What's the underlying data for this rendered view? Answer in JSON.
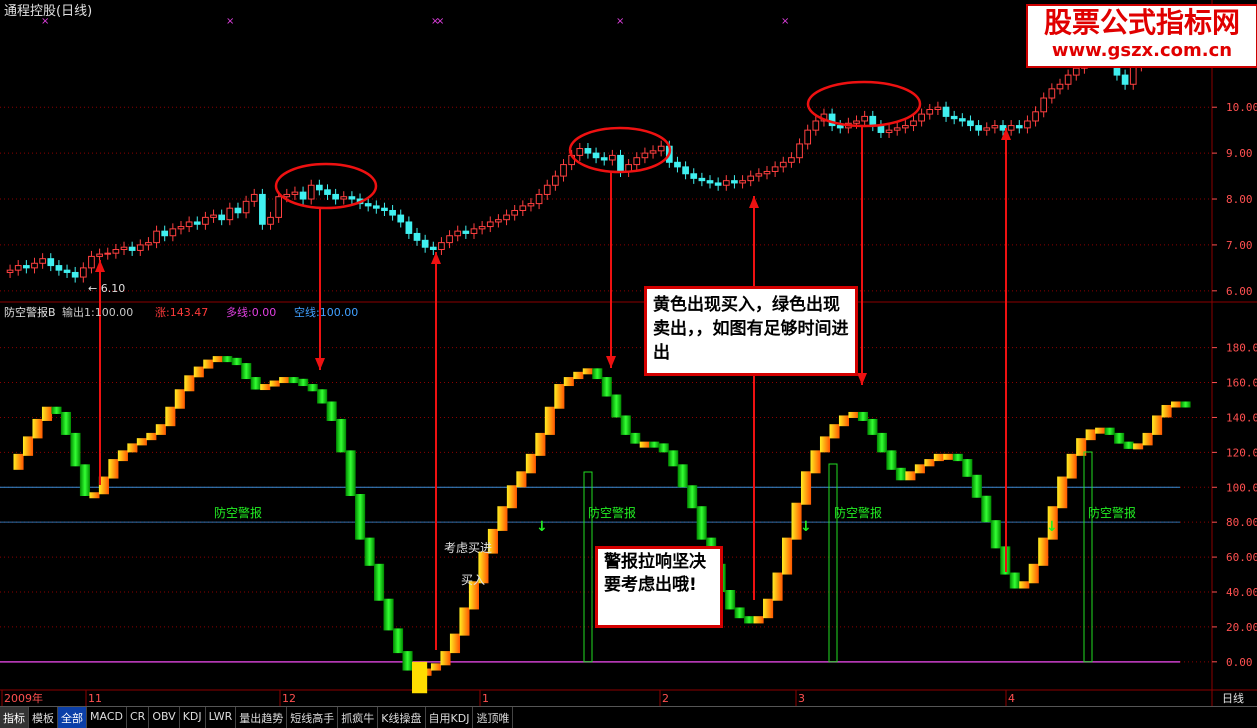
{
  "title": "通程控股(日线)",
  "brand": {
    "name": "股票公式指标网",
    "url": "www.gszx.com.cn"
  },
  "indicator": {
    "name": "防空警报B",
    "readouts": [
      {
        "label": "输出1",
        "value": "100.00",
        "color": "#c8c8c8"
      },
      {
        "label": "涨",
        "value": "143.47",
        "color": "#ff3a3a"
      },
      {
        "label": "多线",
        "value": "0.00",
        "color": "#e040e0"
      },
      {
        "label": "空线",
        "value": "100.00",
        "color": "#40a0ff"
      }
    ]
  },
  "low_marker": "6.10",
  "annotations": {
    "note1": "黄色出现买入，绿色出现卖出，，如图有足够时间进出",
    "note2": "警报拉响坚决要考虑出哦!",
    "consider_buy": "考虑买进",
    "buy": "买入",
    "alarm": "防空警报"
  },
  "axis": {
    "x_labels": [
      "2009年",
      "11",
      "12",
      "1",
      "2",
      "3",
      "4"
    ],
    "corner": "日线",
    "price_ticks": [
      "6.00",
      "7.00",
      "8.00",
      "9.00",
      "10.00"
    ],
    "osc_ticks": [
      "0.00",
      "20.00",
      "40.00",
      "60.00",
      "80.00",
      "100.00",
      "120.00",
      "140.00",
      "160.00",
      "180.00"
    ]
  },
  "tabs": [
    "指标",
    "模板",
    "全部",
    "MACD",
    "CR",
    "OBV",
    "KDJ",
    "LWR",
    "量出趋势",
    "短线高手",
    "抓疯牛",
    "K线操盘",
    "自用KDJ",
    "逃顶唯"
  ],
  "colors": {
    "up": "#ff4040",
    "down": "#40f0f0",
    "buy": "#ffdd00",
    "sell": "#00dd00",
    "arrow": "#ee1111",
    "grid": "#8b0000"
  },
  "chart_data": [
    {
      "type": "candlestick",
      "title": "通程控股(日线)",
      "ylim": [
        5.8,
        11.9
      ],
      "yticks": [
        6,
        7,
        8,
        9,
        10
      ],
      "close": [
        6.45,
        6.55,
        6.5,
        6.6,
        6.7,
        6.55,
        6.45,
        6.4,
        6.3,
        6.5,
        6.75,
        6.8,
        6.82,
        6.9,
        6.95,
        6.88,
        7,
        7.05,
        7.3,
        7.2,
        7.35,
        7.4,
        7.5,
        7.45,
        7.6,
        7.65,
        7.55,
        7.8,
        7.7,
        7.95,
        8.1,
        7.45,
        7.6,
        8.05,
        8.1,
        8.15,
        8.0,
        8.3,
        8.2,
        8.1,
        8.0,
        8.05,
        8.0,
        7.9,
        7.85,
        7.8,
        7.75,
        7.65,
        7.5,
        7.25,
        7.1,
        6.95,
        6.9,
        7.05,
        7.2,
        7.3,
        7.25,
        7.35,
        7.4,
        7.5,
        7.55,
        7.65,
        7.75,
        7.85,
        7.9,
        8.1,
        8.3,
        8.5,
        8.75,
        8.95,
        9.1,
        9.0,
        8.9,
        8.85,
        8.95,
        8.6,
        8.75,
        8.9,
        9.0,
        9.05,
        9.15,
        8.8,
        8.7,
        8.55,
        8.45,
        8.4,
        8.35,
        8.3,
        8.4,
        8.35,
        8.4,
        8.5,
        8.55,
        8.6,
        8.7,
        8.8,
        8.9,
        9.2,
        9.5,
        9.7,
        9.85,
        9.6,
        9.55,
        9.65,
        9.7,
        9.8,
        9.6,
        9.45,
        9.5,
        9.55,
        9.6,
        9.7,
        9.85,
        9.95,
        10.0,
        9.8,
        9.75,
        9.7,
        9.6,
        9.5,
        9.55,
        9.6,
        9.5,
        9.6,
        9.55,
        9.7,
        9.9,
        10.2,
        10.4,
        10.5,
        10.7,
        10.85,
        11.0,
        11.1,
        11.3,
        11.0,
        10.7,
        10.5,
        10.9,
        11.2,
        11.4,
        11.3,
        11.35,
        11.4
      ],
      "low_label": 6.1
    },
    {
      "type": "area",
      "title": "防空警报B",
      "ylim": [
        -15,
        205
      ],
      "yticks": [
        0,
        20,
        40,
        60,
        80,
        100,
        120,
        140,
        160,
        180
      ],
      "values": [
        110,
        118,
        128,
        138,
        145,
        142,
        130,
        112,
        95,
        96,
        105,
        115,
        120,
        124,
        127,
        130,
        135,
        145,
        155,
        163,
        168,
        172,
        174,
        173,
        170,
        162,
        156,
        158,
        160,
        162,
        161,
        158,
        155,
        148,
        138,
        120,
        95,
        70,
        55,
        35,
        18,
        5,
        -5,
        -8,
        -5,
        -2,
        5,
        15,
        30,
        45,
        62,
        75,
        88,
        100,
        108,
        118,
        130,
        145,
        158,
        162,
        165,
        167,
        162,
        152,
        140,
        130,
        125,
        125,
        124,
        120,
        112,
        100,
        88,
        70,
        55,
        40,
        30,
        25,
        22,
        25,
        35,
        50,
        70,
        90,
        108,
        120,
        128,
        135,
        140,
        142,
        138,
        130,
        120,
        110,
        104,
        108,
        112,
        115,
        118,
        118,
        115,
        106,
        94,
        80,
        65,
        50,
        42,
        45,
        55,
        70,
        88,
        105,
        118,
        127,
        132,
        133,
        130,
        125,
        122,
        124,
        130,
        140,
        146,
        148,
        147
      ]
    }
  ]
}
